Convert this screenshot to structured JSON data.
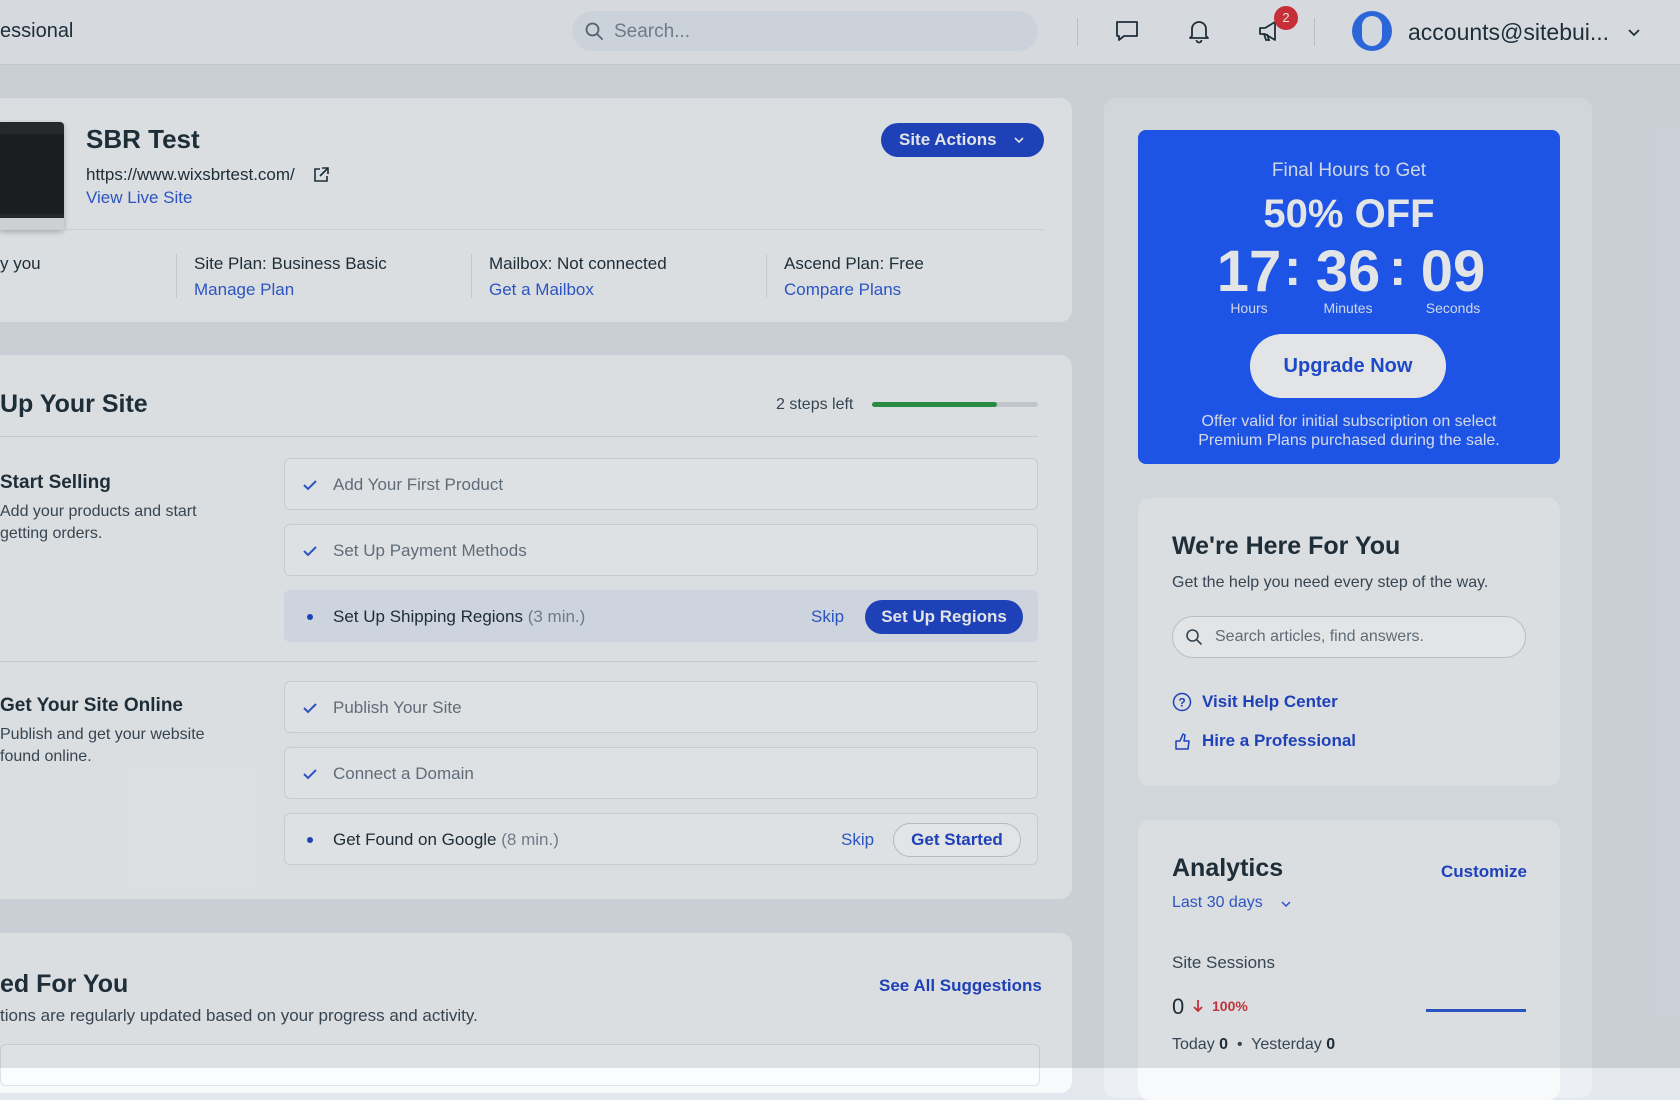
{
  "topbar": {
    "brand": "essional",
    "search_placeholder": "Search...",
    "notification_count": "2",
    "account": "accounts@sitebui..."
  },
  "site": {
    "title": "SBR Test",
    "url": "https://www.wixsbrtest.com/",
    "view_live": "View Live Site",
    "actions_label": "Site Actions",
    "info": [
      {
        "line1": "y you",
        "line2": ""
      },
      {
        "line1": "Site Plan: Business Basic",
        "line2": "Manage Plan"
      },
      {
        "line1": "Mailbox: Not connected",
        "line2": "Get a Mailbox"
      },
      {
        "line1": "Ascend Plan: Free",
        "line2": "Compare Plans"
      }
    ]
  },
  "setup": {
    "title": "Up Your Site",
    "steps_left": "2 steps left",
    "progress": 0.75,
    "groups": [
      {
        "title": "Start Selling",
        "desc": "Add your products and start getting orders.",
        "tasks": [
          {
            "label": "Add Your First Product",
            "status": "done"
          },
          {
            "label": "Set Up Payment Methods",
            "status": "done"
          },
          {
            "label": "Set Up Shipping Regions",
            "duration": "(3 min.)",
            "status": "active",
            "skip": "Skip",
            "action": "Set Up Regions"
          }
        ]
      },
      {
        "title": "Get Your Site Online",
        "desc": "Publish and get your website found online.",
        "tasks": [
          {
            "label": "Publish Your Site",
            "status": "done"
          },
          {
            "label": "Connect a Domain",
            "status": "done"
          },
          {
            "label": "Get Found on Google",
            "duration": "(8 min.)",
            "status": "pending",
            "skip": "Skip",
            "action": "Get Started"
          }
        ]
      }
    ]
  },
  "suggestions": {
    "title": "ed For You",
    "desc": "tions are regularly updated based on your progress and activity.",
    "see_all": "See All Suggestions"
  },
  "promo": {
    "subtitle": "Final Hours to Get",
    "title": "50% OFF",
    "hours": "17",
    "minutes": "36",
    "seconds": "09",
    "hours_label": "Hours",
    "minutes_label": "Minutes",
    "seconds_label": "Seconds",
    "button": "Upgrade Now",
    "note": "Offer valid for initial subscription on select Premium Plans purchased during the sale."
  },
  "help": {
    "title": "We're Here For You",
    "desc": "Get the help you need every step of the way.",
    "search_placeholder": "Search articles, find answers.",
    "link_help_center": "Visit Help Center",
    "link_hire": "Hire a Professional"
  },
  "analytics": {
    "title": "Analytics",
    "customize": "Customize",
    "range": "Last 30 days",
    "sessions_label": "Site Sessions",
    "sessions_value": "0",
    "sessions_change": "100%",
    "today_label": "Today",
    "today_value": "0",
    "yesterday_label": "Yesterday",
    "yesterday_value": "0"
  },
  "colors": {
    "primary": "#2046cc",
    "link": "#2f5cd6",
    "promo": "#1f5cff",
    "success": "#2f9a49",
    "danger": "#d9363e"
  }
}
